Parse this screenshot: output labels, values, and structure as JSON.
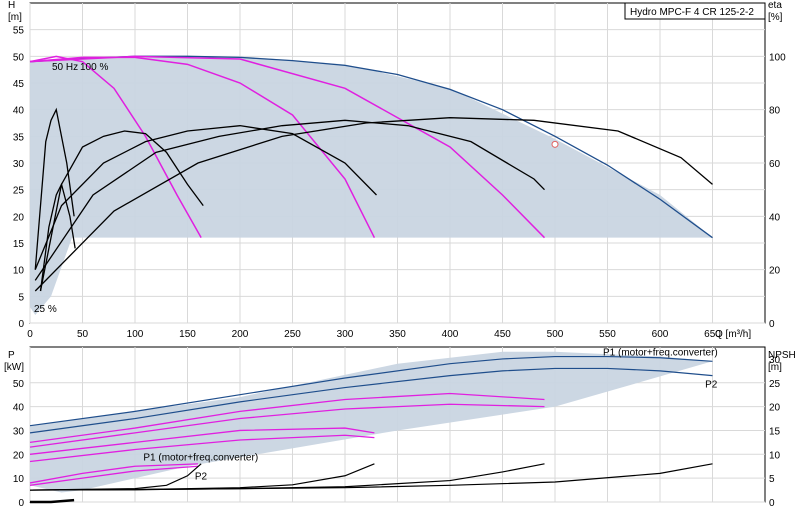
{
  "colors": {
    "envelope_fill": "#c9d5e2",
    "max_curve": "#1f4e8c",
    "speed_curve": "#e020e0",
    "eff_curve": "#000000",
    "grid": "#d9d9d9",
    "duty_point": "#e06060",
    "p_label": "#1f4e8c"
  },
  "chart_data": [
    {
      "type": "line",
      "name": "qh",
      "title": "Hydro MPC-F 4 CR 125-2-2",
      "ylabel": "H",
      "yunit": "[m]",
      "xlabel": "Q",
      "xunit": "[m³/h]",
      "y2label": "eta",
      "y2unit": "[%]",
      "xlim": [
        0,
        700
      ],
      "ylim": [
        0,
        60
      ],
      "y2lim": [
        0,
        120
      ],
      "xticks": [
        0,
        50,
        100,
        150,
        200,
        250,
        300,
        350,
        400,
        450,
        500,
        550,
        600,
        650
      ],
      "yticks": [
        0,
        5,
        10,
        15,
        20,
        25,
        30,
        35,
        40,
        45,
        50,
        55
      ],
      "y2ticks": [
        0,
        20,
        40,
        60,
        80,
        100
      ],
      "grid": true,
      "annotations": [
        "50 Hz",
        "100 %",
        "25 %"
      ],
      "duty_point": {
        "x": 500,
        "y": 33.5
      },
      "envelope": [
        [
          0,
          49
        ],
        [
          100,
          50
        ],
        [
          200,
          50
        ],
        [
          300,
          48.5
        ],
        [
          400,
          44
        ],
        [
          500,
          34.5
        ],
        [
          600,
          24
        ],
        [
          650,
          16
        ],
        [
          40,
          16
        ],
        [
          20,
          5
        ],
        [
          5,
          1.5
        ],
        [
          0,
          3
        ]
      ],
      "series": [
        {
          "role": "max",
          "x": [
            0,
            50,
            100,
            150,
            200,
            250,
            300,
            350,
            400,
            450,
            500,
            550,
            600,
            650
          ],
          "y": [
            49,
            49.6,
            50,
            50,
            49.8,
            49.2,
            48.3,
            46.6,
            43.8,
            40,
            35,
            29.6,
            23.2,
            16
          ]
        },
        {
          "role": "speed",
          "x": [
            0,
            25,
            50,
            80,
            110,
            140,
            163
          ],
          "y": [
            49,
            50,
            49,
            44,
            35,
            24,
            16
          ]
        },
        {
          "role": "speed",
          "x": [
            0,
            50,
            100,
            150,
            200,
            250,
            300,
            328
          ],
          "y": [
            49,
            49.8,
            49.8,
            48.5,
            45,
            39,
            27,
            16
          ]
        },
        {
          "role": "speed",
          "x": [
            0,
            100,
            200,
            300,
            400,
            450,
            490
          ],
          "y": [
            49,
            50,
            49.5,
            44,
            33,
            24,
            16
          ]
        },
        {
          "role": "eff",
          "x": [
            10,
            30,
            50,
            70,
            90,
            110,
            130,
            150,
            165
          ],
          "y": [
            6,
            26,
            33,
            35,
            36,
            35.5,
            32,
            26,
            22
          ]
        },
        {
          "role": "eff",
          "x": [
            5,
            30,
            70,
            110,
            150,
            200,
            250,
            300,
            330
          ],
          "y": [
            10,
            22,
            30,
            34,
            36,
            37,
            35.5,
            30,
            24
          ]
        },
        {
          "role": "eff",
          "x": [
            5,
            60,
            120,
            180,
            240,
            300,
            360,
            420,
            480,
            490
          ],
          "y": [
            8,
            24,
            32,
            35,
            37,
            38,
            37,
            34,
            27,
            25
          ]
        },
        {
          "role": "eff",
          "x": [
            5,
            80,
            160,
            240,
            320,
            400,
            480,
            560,
            620,
            650
          ],
          "y": [
            6,
            21,
            30,
            35,
            37.5,
            38.5,
            38,
            36,
            31,
            26
          ]
        },
        {
          "role": "eff",
          "x": [
            5,
            15,
            20,
            25,
            35,
            42
          ],
          "y": [
            10,
            34,
            38,
            40,
            30,
            20
          ]
        },
        {
          "role": "eff",
          "x": [
            10,
            18,
            25,
            30,
            38,
            43
          ],
          "y": [
            6,
            18,
            24,
            26,
            20,
            14
          ]
        }
      ]
    },
    {
      "type": "line",
      "name": "power_npsh",
      "ylabel": "P",
      "yunit": "[kW]",
      "y2label": "NPSH",
      "y2unit": "[m]",
      "xlim": [
        0,
        700
      ],
      "ylim": [
        0,
        65
      ],
      "y2lim": [
        0,
        32.5
      ],
      "yticks": [
        0,
        10,
        20,
        30,
        40,
        50
      ],
      "y2ticks": [
        0,
        5,
        10,
        15,
        20,
        25,
        30
      ],
      "grid": true,
      "labels": [
        {
          "text": "P1 (motor+freq.converter)",
          "anchor": "right",
          "x": 655,
          "y": 61.5
        },
        {
          "text": "P2",
          "anchor": "left",
          "x": 643,
          "y": 48
        },
        {
          "text": "P1 (motor+freq.converter)",
          "anchor": "left",
          "x": 108,
          "y": 17.5
        },
        {
          "text": "P2",
          "anchor": "left",
          "x": 157,
          "y": 9.5
        }
      ],
      "envelope": [
        [
          0,
          32
        ],
        [
          200,
          44
        ],
        [
          350,
          58
        ],
        [
          450,
          63
        ],
        [
          500,
          63
        ],
        [
          600,
          61
        ],
        [
          650,
          59
        ],
        [
          500,
          40
        ],
        [
          350,
          30
        ],
        [
          150,
          15
        ],
        [
          50,
          5
        ],
        [
          30,
          4
        ],
        [
          0,
          7
        ]
      ],
      "series": [
        {
          "role": "max",
          "x": [
            0,
            100,
            200,
            300,
            400,
            450,
            500,
            550,
            600,
            650
          ],
          "y": [
            32,
            38,
            45,
            52,
            58,
            60,
            61,
            61,
            60.5,
            59
          ]
        },
        {
          "role": "max",
          "x": [
            0,
            100,
            200,
            300,
            400,
            450,
            500,
            550,
            600,
            650
          ],
          "y": [
            29,
            35,
            42,
            48,
            53,
            55,
            56,
            56,
            55,
            53
          ]
        },
        {
          "role": "speed",
          "x": [
            0,
            100,
            200,
            300,
            400,
            490
          ],
          "y": [
            25,
            31,
            38,
            43,
            45.5,
            43
          ]
        },
        {
          "role": "speed",
          "x": [
            0,
            100,
            200,
            300,
            400,
            490
          ],
          "y": [
            23,
            29,
            35,
            39,
            41,
            40
          ]
        },
        {
          "role": "speed",
          "x": [
            0,
            100,
            200,
            300,
            328
          ],
          "y": [
            20,
            25,
            30,
            31,
            29
          ]
        },
        {
          "role": "speed",
          "x": [
            0,
            100,
            200,
            300,
            328
          ],
          "y": [
            17,
            22,
            26,
            28,
            27
          ]
        },
        {
          "role": "speed",
          "x": [
            0,
            50,
            100,
            160
          ],
          "y": [
            8,
            12,
            15,
            16
          ]
        },
        {
          "role": "speed",
          "x": [
            0,
            50,
            100,
            160
          ],
          "y": [
            7,
            10,
            13,
            15
          ]
        },
        {
          "role": "npsh",
          "x": [
            0,
            100,
            200,
            300,
            400,
            500,
            600,
            650
          ],
          "y": [
            2.5,
            2.6,
            2.8,
            3,
            3.5,
            4.2,
            6,
            8
          ]
        },
        {
          "role": "npsh",
          "x": [
            0,
            100,
            200,
            250,
            300,
            328
          ],
          "y": [
            2.5,
            2.6,
            3,
            3.6,
            5.5,
            8
          ]
        },
        {
          "role": "npsh",
          "x": [
            0,
            100,
            200,
            300,
            400,
            450,
            490
          ],
          "y": [
            2.5,
            2.6,
            2.8,
            3.2,
            4.5,
            6.3,
            8
          ]
        },
        {
          "role": "npsh",
          "x": [
            0,
            100,
            130,
            150,
            163
          ],
          "y": [
            2.5,
            2.8,
            3.5,
            5.5,
            8
          ]
        },
        {
          "role": "npsh_low",
          "x": [
            0,
            20,
            42
          ],
          "y": [
            0,
            0,
            0.4
          ]
        }
      ]
    }
  ]
}
